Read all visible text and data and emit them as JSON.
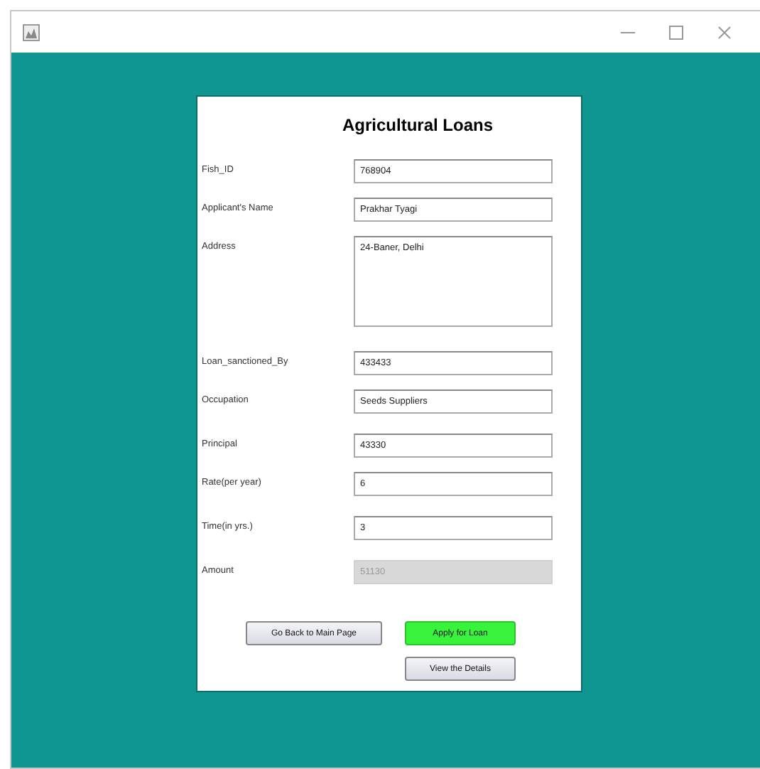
{
  "form": {
    "title": "Agricultural Loans",
    "fields": [
      {
        "label": "Fish_ID",
        "value": "768904",
        "kind": "line",
        "disabled": false
      },
      {
        "label": "Applicant's Name",
        "value": "Prakhar Tyagi",
        "kind": "line",
        "disabled": false
      },
      {
        "label": "Address",
        "value": "24-Baner, Delhi",
        "kind": "area",
        "disabled": false
      },
      {
        "label": "Loan_sanctioned_By",
        "value": "433433",
        "kind": "line",
        "disabled": false
      },
      {
        "label": "Occupation",
        "value": "Seeds Suppliers",
        "kind": "line",
        "disabled": false
      },
      {
        "label": "Principal",
        "value": "43330",
        "kind": "line",
        "disabled": false
      },
      {
        "label": "Rate(per year)",
        "value": "6",
        "kind": "line",
        "disabled": false
      },
      {
        "label": "Time(in yrs.)",
        "value": "3",
        "kind": "line",
        "disabled": false
      },
      {
        "label": "Amount",
        "value": "51130",
        "kind": "line",
        "disabled": true
      }
    ],
    "buttons": [
      {
        "label": "Go Back to Main Page",
        "kind": "plain"
      },
      {
        "label": "Apply for Loan",
        "kind": "green"
      },
      {
        "label": "View the Details",
        "kind": "plain"
      }
    ]
  }
}
